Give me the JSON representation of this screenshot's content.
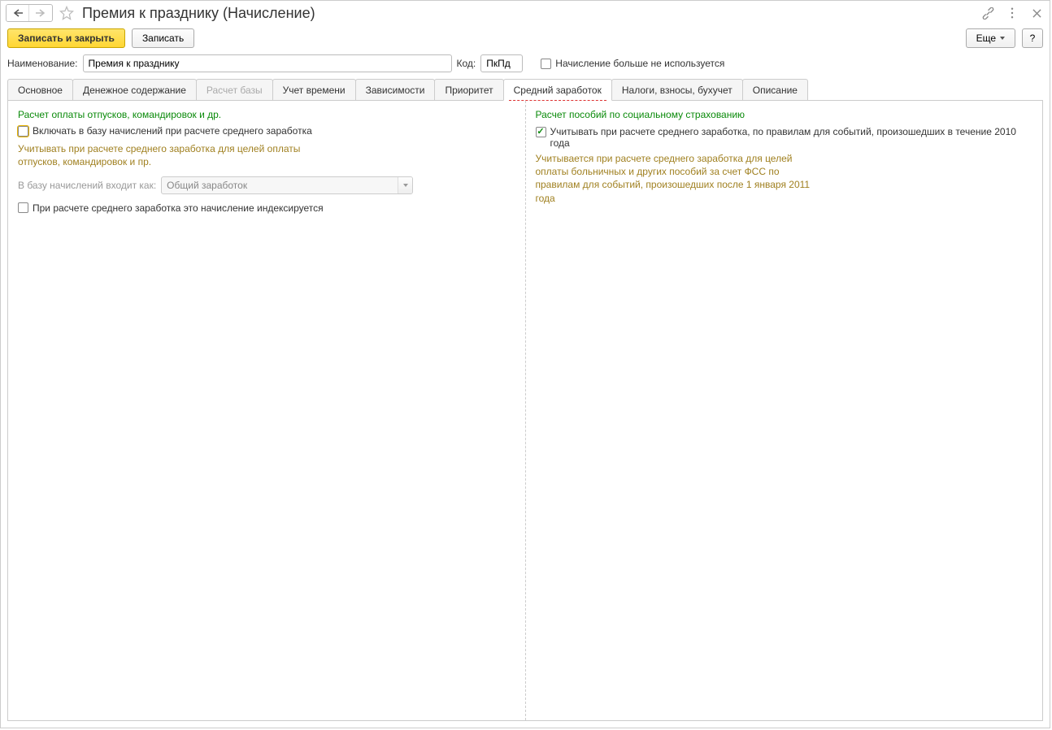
{
  "title": "Премия к празднику (Начисление)",
  "toolbar": {
    "save_close": "Записать и закрыть",
    "save": "Записать",
    "more": "Еще",
    "help": "?"
  },
  "form": {
    "name_label": "Наименование:",
    "name_value": "Премия к празднику",
    "code_label": "Код:",
    "code_value": "ПкПд",
    "not_used_label": "Начисление больше не используется"
  },
  "tabs": [
    {
      "label": "Основное"
    },
    {
      "label": "Денежное содержание"
    },
    {
      "label": "Расчет базы",
      "disabled": true
    },
    {
      "label": "Учет времени"
    },
    {
      "label": "Зависимости"
    },
    {
      "label": "Приоритет"
    },
    {
      "label": "Средний заработок",
      "active": true
    },
    {
      "label": "Налоги, взносы, бухучет"
    },
    {
      "label": "Описание"
    }
  ],
  "left": {
    "title": "Расчет оплаты отпусков, командировок и др.",
    "include_label": "Включать в базу начислений при расчете среднего заработка",
    "hint": "Учитывать при расчете среднего заработка для целей оплаты отпусков, командировок и пр.",
    "base_label": "В базу начислений входит как:",
    "base_value": "Общий заработок",
    "index_label": "При расчете среднего заработка это начисление индексируется"
  },
  "right": {
    "title": "Расчет пособий по социальному страхованию",
    "consider_label": "Учитывать при расчете среднего заработка, по правилам для событий, произошедших в течение 2010 года",
    "hint": "Учитывается при расчете среднего заработка для целей оплаты больничных и других пособий за счет ФСС по правилам для событий, произошедших после 1 января 2011 года"
  }
}
